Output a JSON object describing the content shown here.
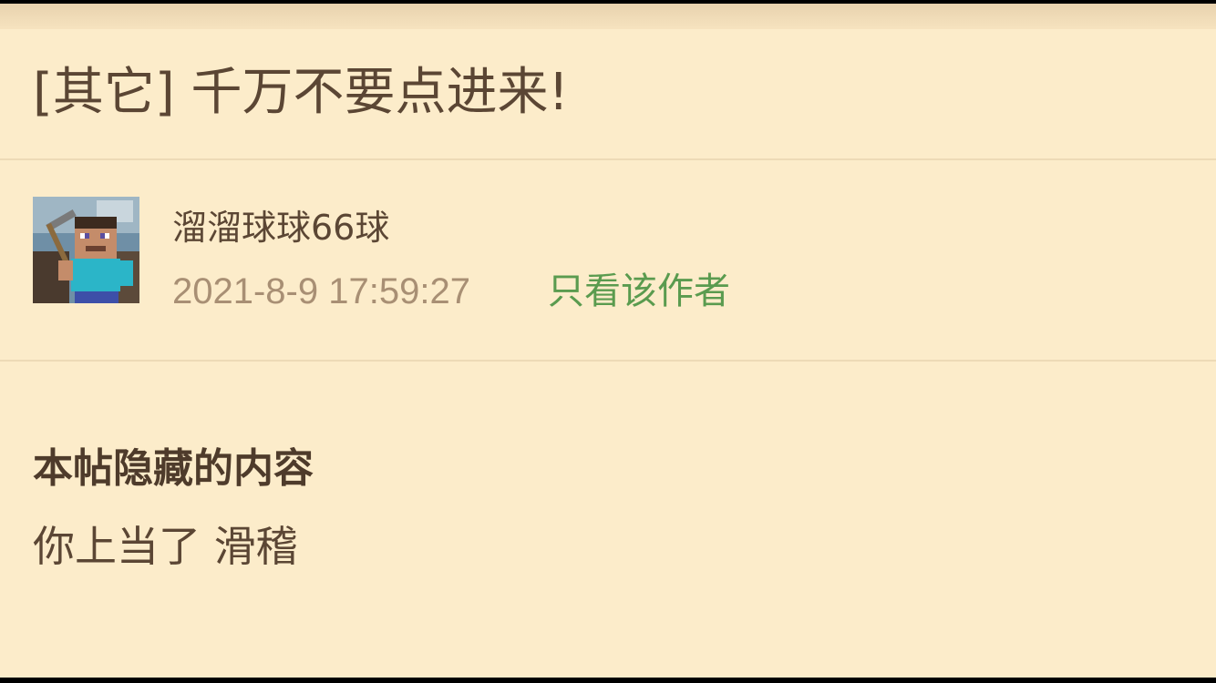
{
  "post": {
    "title": "[其它] 千万不要点进来!",
    "author": {
      "username": "溜溜球球66球",
      "avatar_icon": "minecraft-steve-avatar"
    },
    "timestamp": "2021-8-9 17:59:27",
    "author_only_label": "只看该作者",
    "hidden_content": {
      "heading": "本帖隐藏的内容",
      "text": "你上当了 滑稽"
    }
  },
  "colors": {
    "background": "#fcecca",
    "text": "#5b4634",
    "timestamp": "#a88f74",
    "link_green": "#5a9b4f",
    "divider": "#eddab6"
  }
}
